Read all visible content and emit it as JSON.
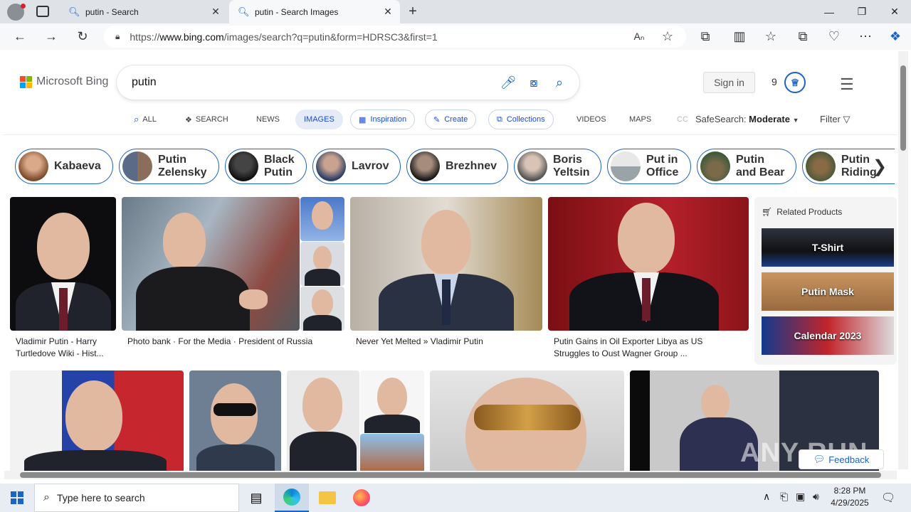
{
  "browser": {
    "tabs": [
      {
        "title": "putin - Search",
        "active": false
      },
      {
        "title": "putin - Search Images",
        "active": true
      }
    ],
    "url_prefix": "https://",
    "url_domain": "www.bing.com",
    "url_path": "/images/search?q=putin&form=HDRSC3&first=1"
  },
  "bing": {
    "logo_text": "Microsoft Bing",
    "query": "putin",
    "signin_label": "Sign in",
    "points": "9",
    "scopes": [
      {
        "label": "ALL",
        "icon": "search-icon"
      },
      {
        "label": "SEARCH",
        "icon": "chat-icon"
      },
      {
        "label": "NEWS"
      },
      {
        "label": "IMAGES",
        "active": true
      },
      {
        "label": "Inspiration",
        "icon": "inspiration-icon",
        "pill": true
      },
      {
        "label": "Create",
        "icon": "create-icon",
        "pill": true
      },
      {
        "label": "Collections",
        "icon": "collections-icon",
        "pill": true
      },
      {
        "label": "VIDEOS"
      },
      {
        "label": "MAPS"
      },
      {
        "label": "CC"
      }
    ],
    "safesearch_label": "SafeSearch:",
    "safesearch_value": "Moderate",
    "filter_label": "Filter"
  },
  "related_searches": [
    {
      "line1": "Kabaeva",
      "line2": ""
    },
    {
      "line1": "Putin",
      "line2": "Zelensky"
    },
    {
      "line1": "Black",
      "line2": "Putin"
    },
    {
      "line1": "Lavrov",
      "line2": ""
    },
    {
      "line1": "Brezhnev",
      "line2": ""
    },
    {
      "line1": "Boris",
      "line2": "Yeltsin"
    },
    {
      "line1": "Put in",
      "line2": "Office"
    },
    {
      "line1": "Putin",
      "line2": "and Bear"
    },
    {
      "line1": "Putin",
      "line2": "Riding"
    }
  ],
  "results": [
    {
      "caption_line1": "Vladimir Putin - Harry",
      "caption_line2": "Turtledove Wiki - Hist..."
    },
    {
      "caption_line1": "Photo bank · For the Media · President of Russia",
      "caption_line2": ""
    },
    {
      "caption_line1": "Never Yet Melted » Vladimir Putin",
      "caption_line2": ""
    },
    {
      "caption_line1": "Putin Gains in Oil Exporter Libya as US",
      "caption_line2": "Struggles to Oust Wagner Group ..."
    }
  ],
  "related_products": {
    "header": "Related Products",
    "items": [
      "T-Shirt",
      "Putin Mask",
      "Calendar 2023"
    ]
  },
  "feedback_label": "Feedback",
  "watermark_text": "ANY RUN",
  "taskbar": {
    "search_placeholder": "Type here to search",
    "time": "8:28 PM",
    "date": "4/29/2025"
  },
  "colors": {
    "bing_blue": "#174ae4",
    "ms_red": "#f25022",
    "ms_green": "#7fba00",
    "ms_blue": "#00a4ef",
    "ms_yellow": "#ffb900"
  }
}
